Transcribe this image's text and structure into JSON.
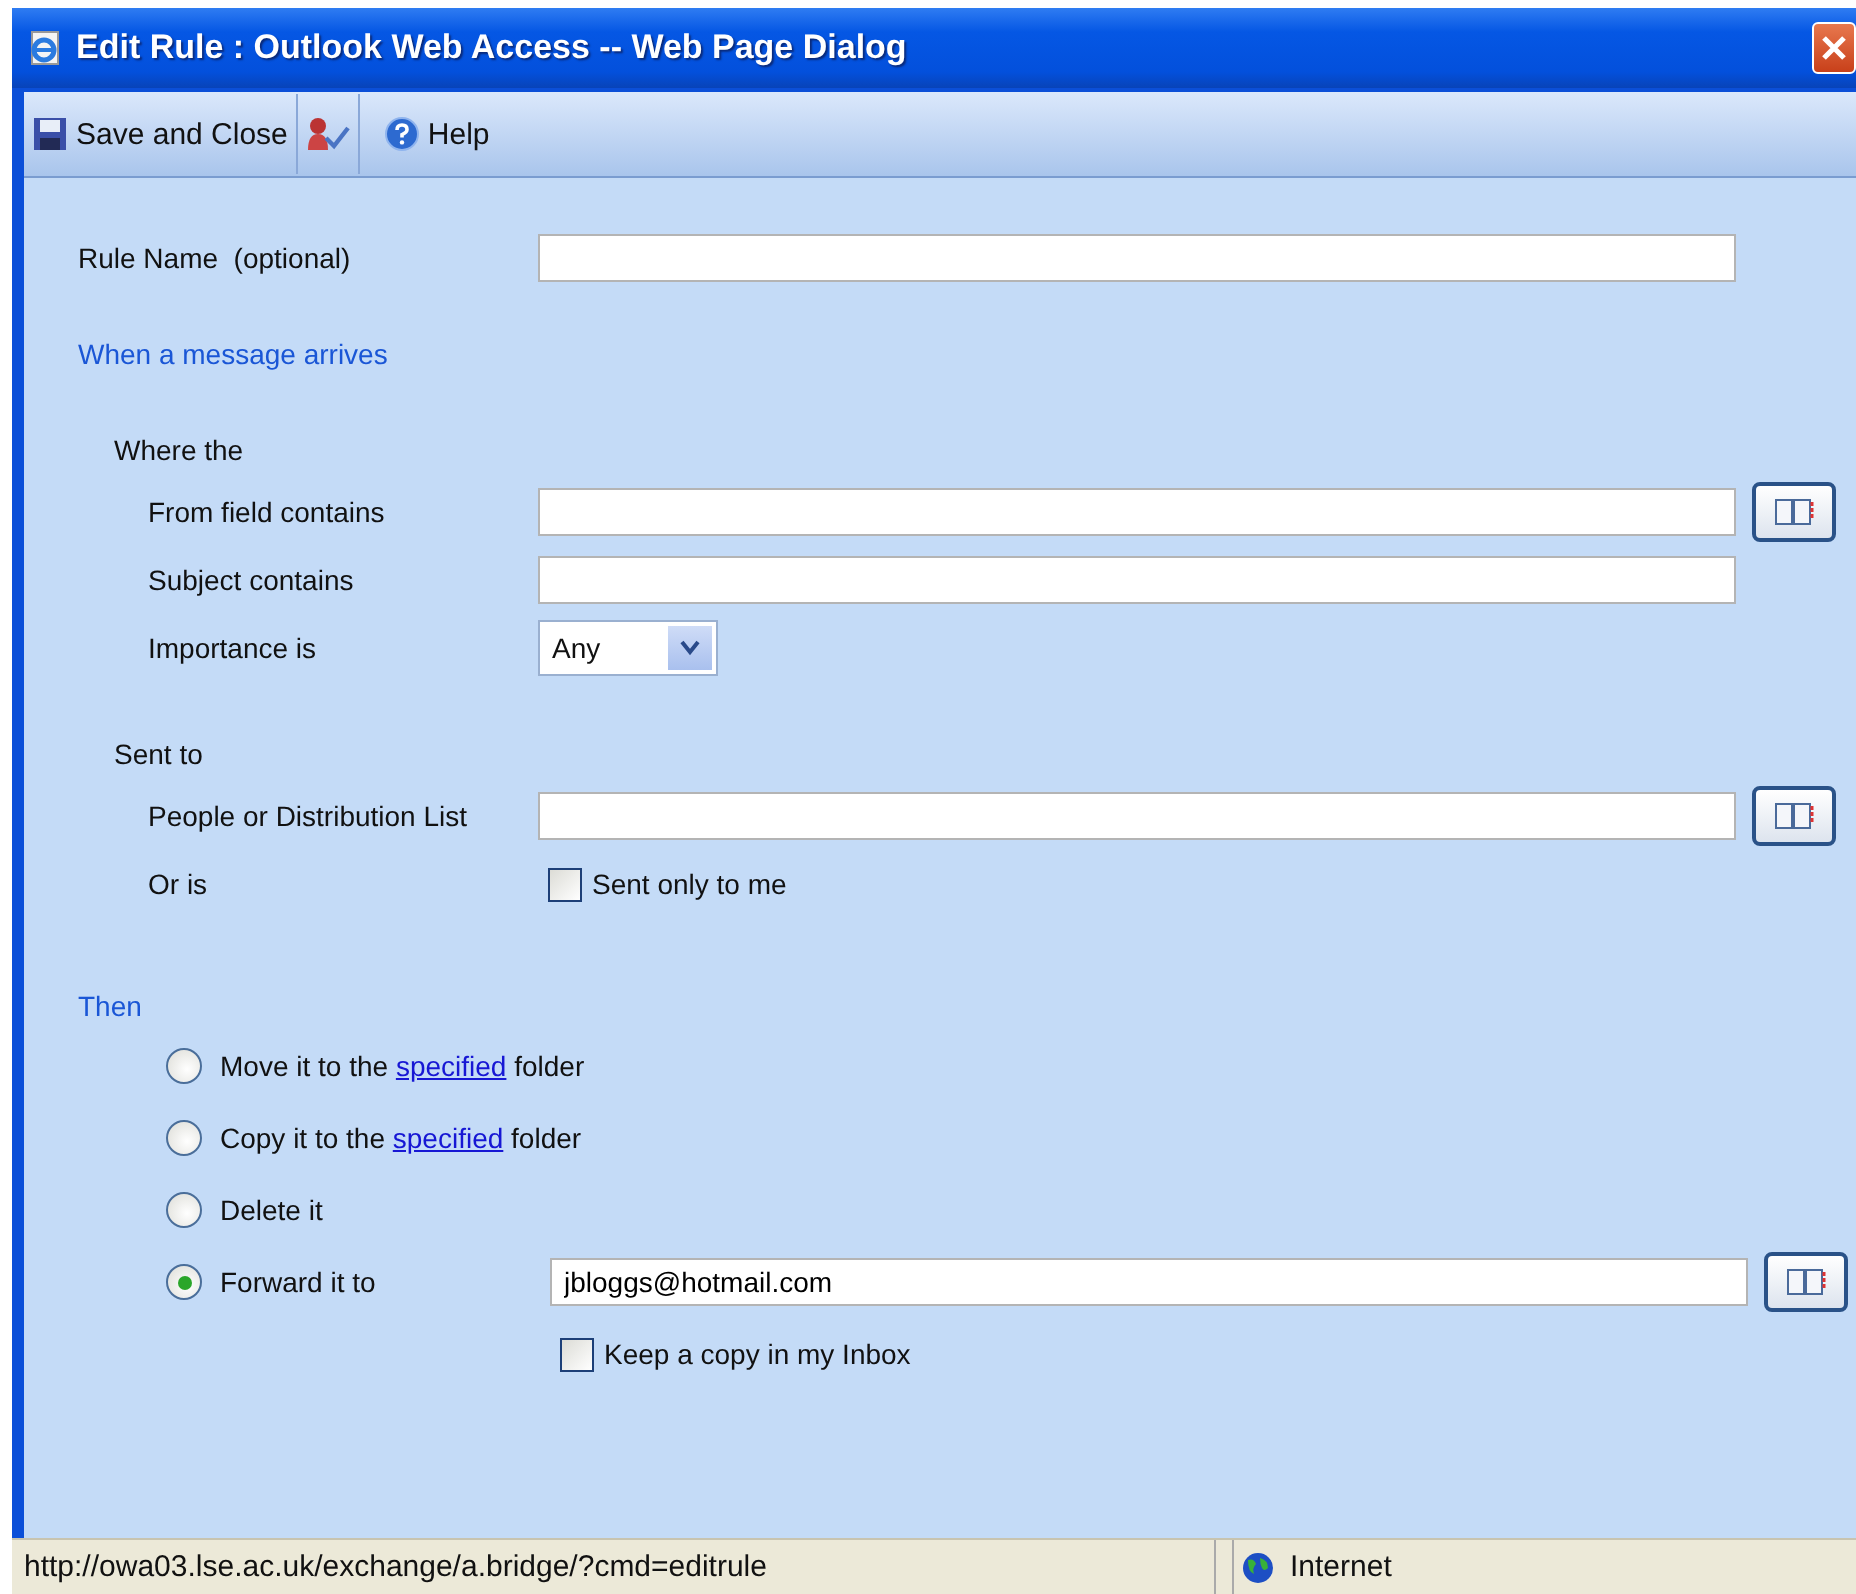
{
  "window": {
    "title": "Edit Rule : Outlook Web Access -- Web Page Dialog"
  },
  "toolbar": [
    {
      "kind": "save",
      "label": "Save and Close"
    },
    {
      "kind": "check"
    },
    {
      "kind": "help",
      "label": "Help"
    }
  ],
  "rule_name": {
    "label": "Rule Name  (optional)"
  },
  "conditions": {
    "heading": "When a message arrives",
    "groups": [
      {
        "label": "Where the",
        "rows": [
          {
            "kind": "text",
            "label": "From field contains",
            "address_book": true
          },
          {
            "kind": "text",
            "label": "Subject contains",
            "address_book": false
          },
          {
            "kind": "select",
            "label": "Importance is",
            "value": "Any"
          }
        ]
      },
      {
        "label": "Sent to",
        "rows": [
          {
            "kind": "text",
            "label": "People or Distribution List",
            "address_book": true
          },
          {
            "kind": "checkbox",
            "label": "Or is",
            "option": "Sent only to me",
            "checked": false
          }
        ]
      }
    ]
  },
  "actions": {
    "heading": "Then",
    "options": [
      {
        "before": "Move it to the ",
        "link": "specified",
        "after": " folder",
        "selected": false
      },
      {
        "before": "Copy it to the ",
        "link": "specified",
        "after": " folder",
        "selected": false
      },
      {
        "before": "Delete it",
        "selected": false
      },
      {
        "before": "Forward it to",
        "selected": true,
        "value": "jbloggs@hotmail.com",
        "address_book": true,
        "keep_copy": {
          "label": "Keep a copy in my Inbox",
          "checked": false
        }
      }
    ]
  },
  "status_bar": {
    "url": "http://owa03.lse.ac.uk/exchange/a.bridge/?cmd=editrule",
    "zone": "Internet"
  }
}
